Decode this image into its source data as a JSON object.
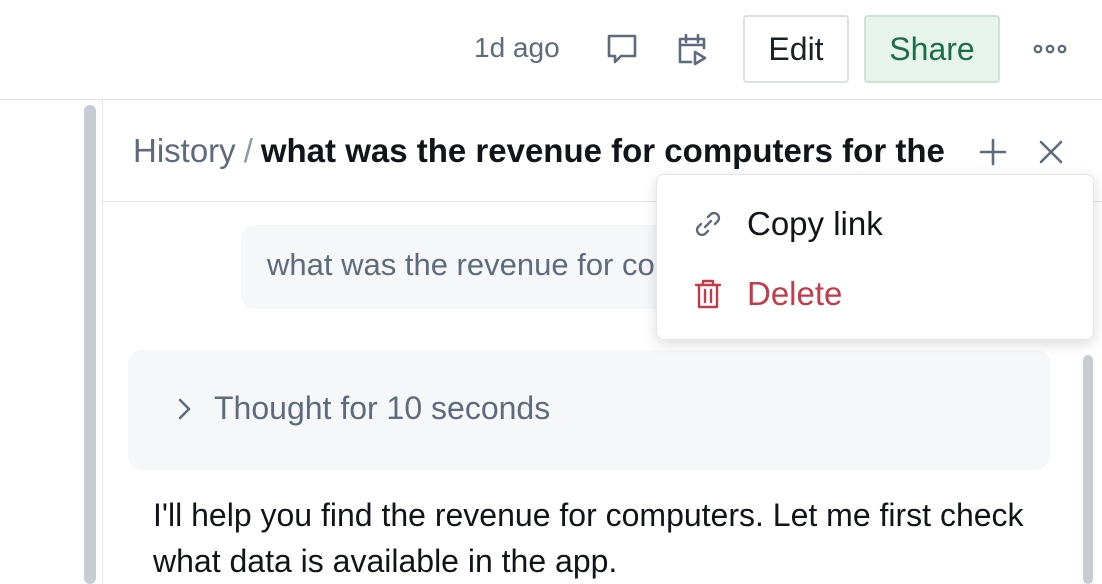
{
  "header": {
    "timestamp": "1d ago",
    "edit_label": "Edit",
    "share_label": "Share",
    "icons": [
      "comment-icon",
      "calendar-play-icon",
      "more-horizontal-icon"
    ]
  },
  "panel": {
    "breadcrumb_root": "History",
    "breadcrumb_separator": "/",
    "breadcrumb_title": "what was the revenue for computers for the",
    "icons": [
      "plus-icon",
      "close-icon"
    ]
  },
  "conversation": {
    "user_message": "what was the revenue for computers for the",
    "thought_label": "Thought for 10 seconds",
    "assistant_message": "I'll help you find the revenue for computers. Let me first check what data is available in the app."
  },
  "menu": {
    "items": [
      {
        "label": "Copy link",
        "icon": "link-icon"
      },
      {
        "label": "Delete",
        "icon": "trash-icon"
      }
    ]
  },
  "colors": {
    "share_bg": "#e8f3ec",
    "share_text": "#1c6e4a",
    "delete_text": "#c23b4a",
    "muted_text": "#5f6b7c"
  }
}
